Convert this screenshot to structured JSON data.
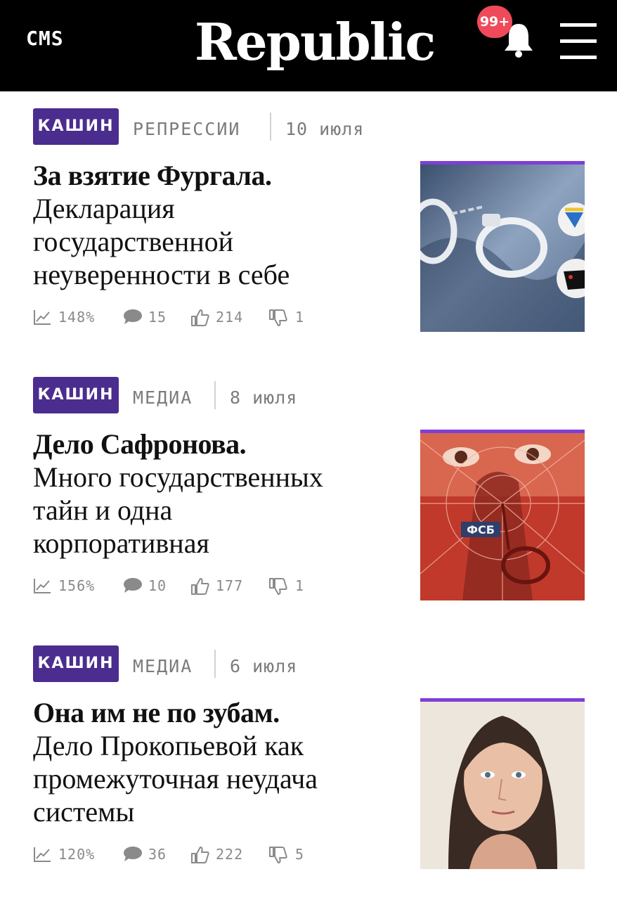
{
  "header": {
    "cms_label": "CMS",
    "logo": "Republic",
    "notifications_badge": "99+"
  },
  "articles": [
    {
      "author": "КАШИН",
      "rubric": "РЕПРЕССИИ",
      "date": "10 июля",
      "title": "За взятие Фургала.",
      "subtitle_lines": [
        "Декларация",
        "государственной",
        "неуверенности в себе"
      ],
      "stats": {
        "growth": "148%",
        "comments": "15",
        "likes": "214",
        "dislikes": "1"
      },
      "image": "handcuffs-badges-illustration"
    },
    {
      "author": "КАШИН",
      "rubric": "МЕДИА",
      "date": "8 июля",
      "title": "Дело Сафронова.",
      "subtitle_lines": [
        "Много государственных",
        "тайн и одна",
        "корпоративная"
      ],
      "stats": {
        "growth": "156%",
        "comments": "10",
        "likes": "177",
        "dislikes": "1"
      },
      "image": "fsb-agent-red-illustration",
      "image_text": "ФСБ"
    },
    {
      "author": "КАШИН",
      "rubric": "МЕДИА",
      "date": "6 июля",
      "title": "Она им не по зубам.",
      "subtitle_lines": [
        "Дело Прокопьевой как",
        "промежуточная неудача",
        "системы"
      ],
      "stats": {
        "growth": "120%",
        "comments": "36",
        "likes": "222",
        "dislikes": "5"
      },
      "image": "woman-portrait-illustration"
    }
  ],
  "colors": {
    "tag_bg": "#4a2d8e",
    "image_border": "#7d3fd6",
    "badge": "#ef4a5a",
    "header_bg": "#000000"
  }
}
